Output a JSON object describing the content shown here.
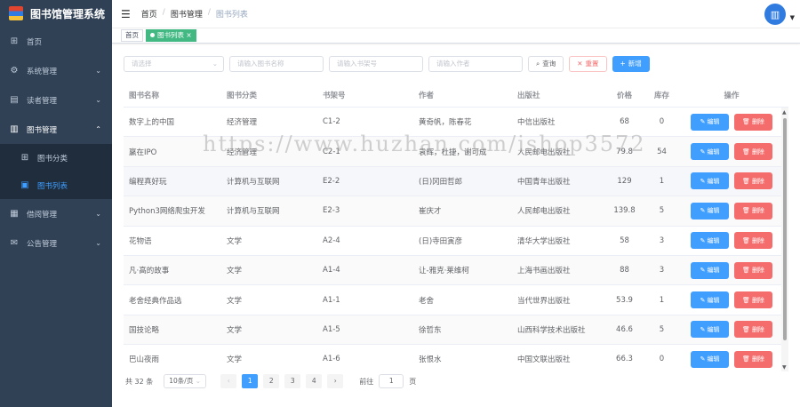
{
  "app": {
    "title": "图书馆管理系统"
  },
  "sidebar": {
    "items": [
      {
        "label": "首页",
        "icon": "dashboard-icon"
      },
      {
        "label": "系统管理",
        "icon": "gear-icon"
      },
      {
        "label": "读者管理",
        "icon": "reader-icon"
      },
      {
        "label": "图书管理",
        "icon": "book-icon"
      },
      {
        "label": "图书分类",
        "icon": "category-icon"
      },
      {
        "label": "图书列表",
        "icon": "list-icon"
      },
      {
        "label": "借阅管理",
        "icon": "borrow-icon"
      },
      {
        "label": "公告管理",
        "icon": "notice-icon"
      }
    ]
  },
  "header": {
    "breadcrumb": [
      "首页",
      "图书管理",
      "图书列表"
    ]
  },
  "tags": {
    "home": "首页",
    "current": "图书列表"
  },
  "filters": {
    "category_placeholder": "请选择",
    "name_placeholder": "请输入图书名称",
    "shelf_placeholder": "请输入书架号",
    "author_placeholder": "请输入作者",
    "search_label": "查询",
    "reset_label": "重置",
    "add_label": "新增"
  },
  "table": {
    "headers": [
      "图书名称",
      "图书分类",
      "书架号",
      "作者",
      "出版社",
      "价格",
      "库存",
      "操作"
    ],
    "edit_label": "编辑",
    "delete_label": "删除",
    "rows": [
      {
        "name": "数字上的中国",
        "category": "经济管理",
        "shelf": "C1-2",
        "author": "黄奇帆，陈春花",
        "publisher": "中信出版社",
        "price": "68",
        "stock": "0"
      },
      {
        "name": "赢在IPO",
        "category": "经济管理",
        "shelf": "C2-1",
        "author": "袁辉，杜捷，谢可成",
        "publisher": "人民邮电出版社",
        "price": "79.8",
        "stock": "54"
      },
      {
        "name": "编程真好玩",
        "category": "计算机与互联网",
        "shelf": "E2-2",
        "author": "(日)冈田哲郎",
        "publisher": "中国青年出版社",
        "price": "129",
        "stock": "1"
      },
      {
        "name": "Python3网络爬虫开发",
        "category": "计算机与互联网",
        "shelf": "E2-3",
        "author": "崔庆才",
        "publisher": "人民邮电出版社",
        "price": "139.8",
        "stock": "5"
      },
      {
        "name": "花物语",
        "category": "文学",
        "shelf": "A2-4",
        "author": "(日)寺田寅彦",
        "publisher": "清华大学出版社",
        "price": "58",
        "stock": "3"
      },
      {
        "name": "凡·高的故事",
        "category": "文学",
        "shelf": "A1-4",
        "author": "让-雅克·莱维柯",
        "publisher": "上海书画出版社",
        "price": "88",
        "stock": "3"
      },
      {
        "name": "老舍经典作品选",
        "category": "文学",
        "shelf": "A1-1",
        "author": "老舍",
        "publisher": "当代世界出版社",
        "price": "53.9",
        "stock": "1"
      },
      {
        "name": "国技论略",
        "category": "文学",
        "shelf": "A1-5",
        "author": "徐哲东",
        "publisher": "山西科学技术出版社",
        "price": "46.6",
        "stock": "5"
      },
      {
        "name": "巴山夜雨",
        "category": "文学",
        "shelf": "A1-6",
        "author": "张恨水",
        "publisher": "中国文联出版社",
        "price": "66.3",
        "stock": "0"
      }
    ]
  },
  "pagination": {
    "total": "共 32 条",
    "page_size": "10条/页",
    "pages": [
      "1",
      "2",
      "3",
      "4"
    ],
    "goto_label": "前往",
    "goto_value": "1",
    "page_unit": "页"
  },
  "watermark": "https://www.huzhan.com/ishop3572",
  "colors": {
    "sidebar": "#304156",
    "primary": "#409eff",
    "danger": "#f56c6c",
    "tag_active": "#42b983"
  }
}
